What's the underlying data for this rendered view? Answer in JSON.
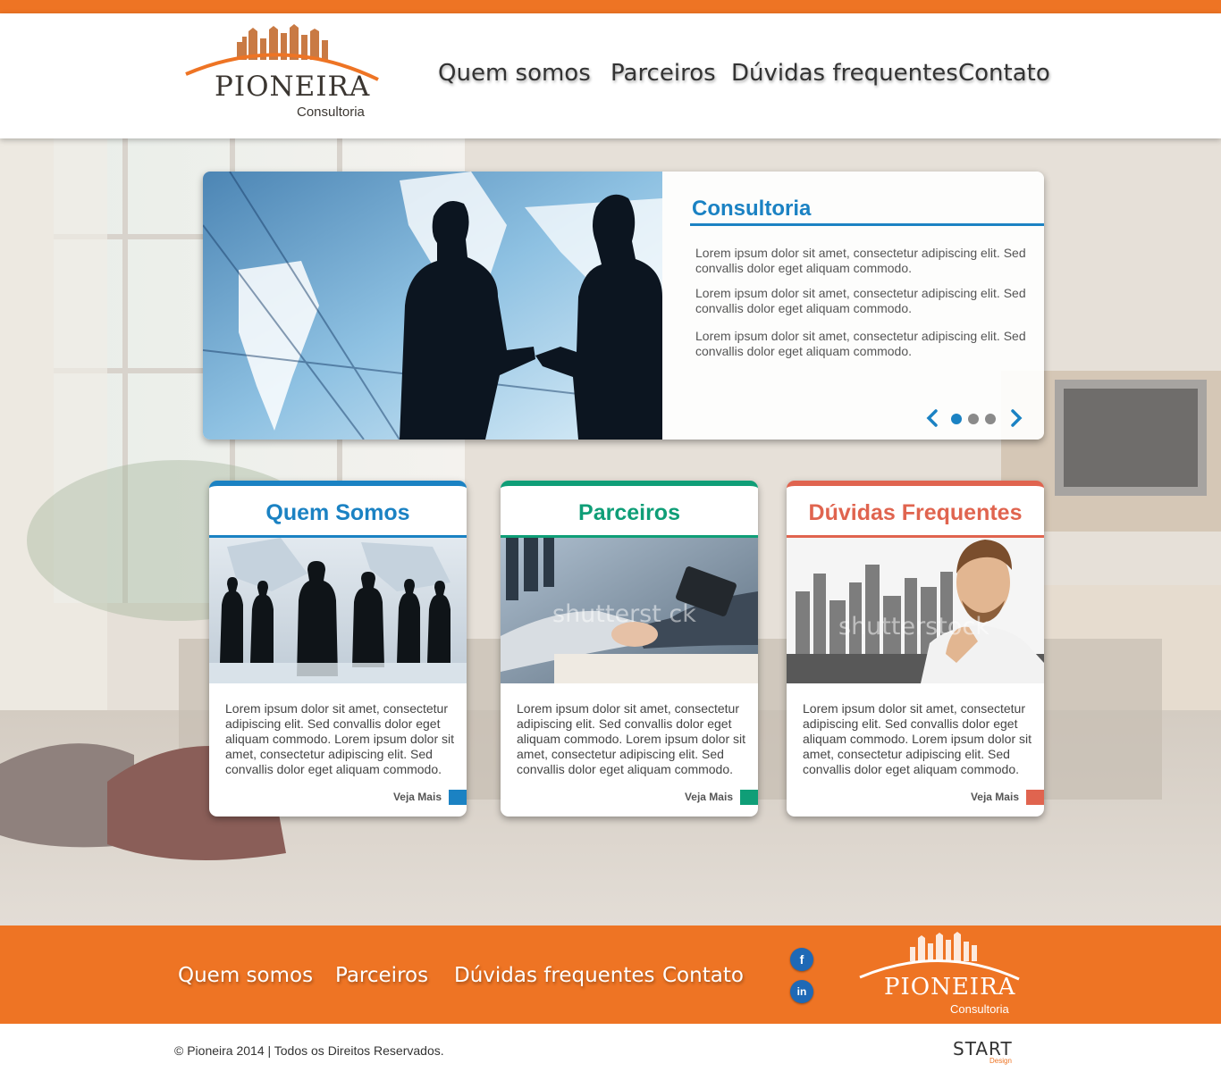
{
  "brand": {
    "name": "Pioneira",
    "tagline": "Consultoria",
    "accent_color": "#ee7424"
  },
  "nav": {
    "items": [
      "Quem somos",
      "Parceiros",
      "Dúvidas frequentes",
      "Contato"
    ]
  },
  "slider": {
    "title": "Consultoria",
    "paragraphs": [
      "Lorem ipsum dolor sit amet, consectetur adipiscing elit. Sed convallis dolor eget aliquam commodo.",
      "Lorem ipsum dolor sit amet, consectetur adipiscing elit. Sed convallis dolor eget aliquam commodo.",
      "Lorem ipsum dolor sit amet, consectetur adipiscing elit. Sed convallis dolor eget aliquam commodo."
    ],
    "image": "handshake-silhouette-world-map",
    "slide_count": 3,
    "active_slide": 1,
    "color": "#1b82c3"
  },
  "cards": [
    {
      "title": "Quem Somos",
      "color": "#1b82c3",
      "image": "business-team-silhouettes",
      "text": "Lorem ipsum dolor sit amet, consectetur adipiscing elit. Sed convallis dolor eget aliquam commodo. Lorem ipsum dolor sit amet, consectetur adipiscing elit. Sed convallis dolor eget aliquam commodo.",
      "more": "Veja Mais"
    },
    {
      "title": "Parceiros",
      "color": "#0f9e77",
      "image": "business-handshake-photo",
      "watermark": "shutterst ck",
      "text": "Lorem ipsum dolor sit amet, consectetur adipiscing elit. Sed convallis dolor eget aliquam commodo. Lorem ipsum dolor sit amet, consectetur adipiscing elit. Sed convallis dolor eget aliquam commodo.",
      "more": "Veja Mais"
    },
    {
      "title": "Dúvidas Frequentes",
      "color": "#e0644f",
      "image": "thinking-man-city-skyline",
      "watermark": "shutterstock",
      "text": "Lorem ipsum dolor sit amet, consectetur adipiscing elit. Sed convallis dolor eget aliquam commodo. Lorem ipsum dolor sit amet, consectetur adipiscing elit. Sed convallis dolor eget aliquam commodo.",
      "more": "Veja Mais"
    }
  ],
  "footer": {
    "nav": [
      "Quem somos",
      "Parceiros",
      "Dúvidas frequentes",
      "Contato"
    ],
    "social": [
      {
        "icon": "facebook-icon",
        "glyph": "f"
      },
      {
        "icon": "linkedin-icon",
        "glyph": "in"
      }
    ],
    "copyright": "© Pioneira 2014 | Todos os Direitos Reservados.",
    "credit": {
      "main": "START",
      "sub": "Design"
    }
  }
}
